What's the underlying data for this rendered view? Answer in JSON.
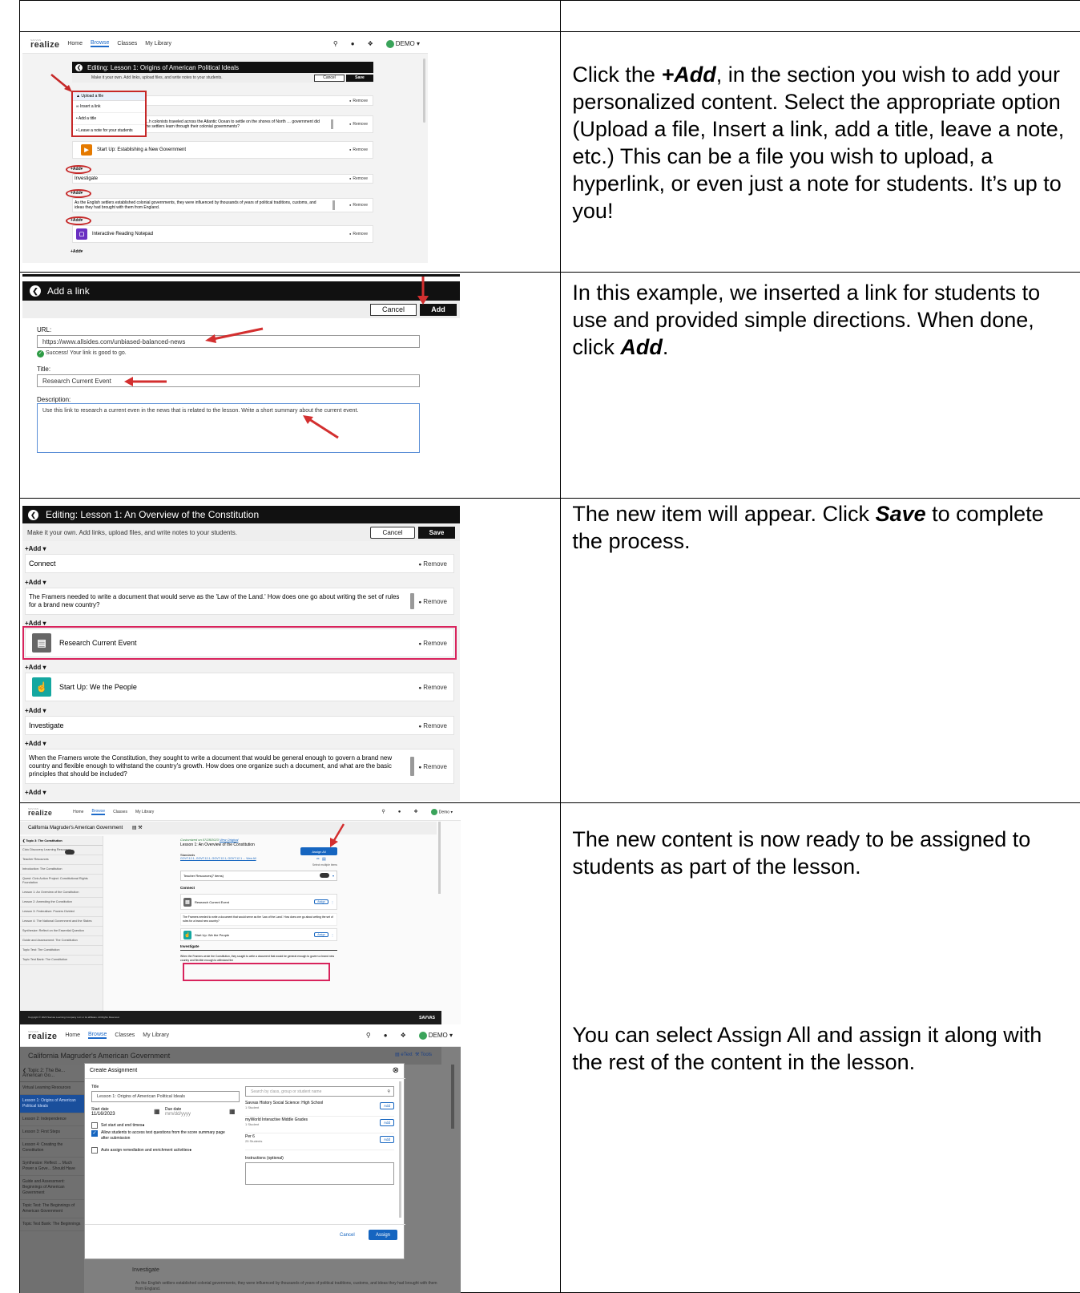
{
  "rows": [
    {
      "instruction_html": "Click the <b><i>+Add</i></b>, in the section you wish to add your personalized content.  Select the appropriate option (Upload a file, Insert a link, add a title, leave a note, etc.) This can be a file you wish to upload, a hyperlink, or even just a note for students.  It’s up to you!"
    },
    {
      "instruction_html": "In this example, we inserted a link for students to use and provided simple directions.  When done, click <b><i>Add</i></b>."
    },
    {
      "instruction_html": "The new item will appear.  Click <b><i>Save</i></b> to complete the process."
    },
    {
      "instruction_html": "The new content is now ready to be assigned to students as part of the lesson."
    },
    {
      "instruction_html": "You can select Assign All and assign it along with the rest of the content in the lesson."
    }
  ],
  "nav": {
    "logo": "realize",
    "logo_small": "SAVVAS",
    "home": "Home",
    "browse": "Browse",
    "classes": "Classes",
    "my_library": "My Library",
    "user": "DEMO ▾",
    "user2": "Demo ▾"
  },
  "ss1": {
    "title": "Editing: Lesson 1: Origins of American Political Ideals",
    "sub": "Make it your own. Add links, upload files, and write notes to your students.",
    "cancel": "Cancel",
    "save": "Save",
    "menu": [
      "Upload a file",
      "Insert a link",
      "Add a title",
      "Leave a note for your students"
    ],
    "item1": "Connect",
    "item2": "…h colonists traveled across the Atlantic Ocean to settle on the shores of North … government did the settlers learn through their colonial governments?",
    "item3": "Start Up: Establishing a New Government",
    "item4": "Investigate",
    "item5": "As the English settlers established colonial governments, they were influenced by thousands of years of political traditions, customs, and ideas they had brought with them from England.",
    "item6": "Interactive Reading Notepad",
    "add": "+Add▾",
    "remove": "Remove"
  },
  "ss2": {
    "title": "Add a link",
    "cancel": "Cancel",
    "add": "Add",
    "url_label": "URL:",
    "url_value": "https://www.allsides.com/unbiased-balanced-news",
    "success": "Success! Your link is good to go.",
    "title_label": "Title:",
    "title_value": "Research Current Event",
    "desc_label": "Description:",
    "desc_value": "Use this link to research a current even in the news that is related to the lesson.  Write a short summary about the current event."
  },
  "ss3": {
    "title": "Editing: Lesson 1: An Overview of the Constitution",
    "sub": "Make it your own. Add links, upload files, and write notes to your students.",
    "cancel": "Cancel",
    "save": "Save",
    "add": "+Add ▾",
    "remove": "Remove",
    "item1": "Connect",
    "item2": "The Framers needed to write a document that would serve as the 'Law of the Land.' How does one go about writing the set of rules for a brand new country?",
    "item3": "Research Current Event",
    "item4": "Start Up: We the People",
    "item5": "Investigate",
    "item6": "When the Framers wrote the Constitution, they sought to write a document that would be general enough to govern a brand new country and flexible enough to withstand the country's growth. How does one organize such a document, and what are the basic principles that should be included?"
  },
  "ss4": {
    "book": "California Magruder's American Government",
    "topic": "Topic 3: The Constitution",
    "side": [
      "Civic Discovery Learning Resources",
      "Teacher Resources",
      "Introduction: The Constitution",
      "Quest: Civic Action Project: Constitutional Rights Foundation",
      "Lesson 1: An Overview of the Constitution",
      "Lesson 2: Amending the Constitution",
      "Lesson 3: Federalism: Powers Divided",
      "Lesson 4: The National Government and the States",
      "Synthesize: Reflect on the Essential Question",
      "Guide and Assessment: The Constitution",
      "Topic Test: The Constitution",
      "Topic Test Bank: The Constitution"
    ],
    "customized": "Customized on 07/28/2023",
    "view_original": "View Original",
    "lesson": "Lesson 1: An Overview of the Constitution",
    "assign_all": "Assign All",
    "standards": "Standards",
    "standards_links": "GOVT.12.1, GOVT.12.1, GOVT.12.1, GOVT.12.1 ... View All",
    "select_multiple": "Select multiple items",
    "teacher_resources": "Teacher Resources(7 items)",
    "connect": "Connect",
    "item_rce": "Research Current Event",
    "assign": "Assign",
    "framers": "The Framers needed to write a document that would serve as the 'Law of the Land.' How does one go about writing the set of rules for a brand new country?",
    "start_up": "Start Up: We the People",
    "investigate": "Investigate",
    "when": "When the Framers wrote the Constitution, they sought to write a document that would be general enough to govern a brand new country and flexible enough to withstand the",
    "footer": "Copyright © 2023 Savvas Learning Company LLC or its affiliates. All Rights Reserved.",
    "footer_logo": "SAVVAS"
  },
  "ss5": {
    "book": "California Magruder's American Government",
    "etext": "eText",
    "tools": "Tools",
    "topic": "Topic 2: The Be... American Go...",
    "side": [
      "Virtual Learning Resources",
      "Lesson 1: Origins of American Political Ideals",
      "Lesson 2: Independence",
      "Lesson 3: First Steps",
      "Lesson 4: Creating the Constitution",
      "Synthesize: Reflect ... Much Power a Gove... Should Have",
      "Guide and Assessment: Beginnings of American Government",
      "Topic Test: The Beginnings of American Government",
      "Topic Test Bank: The Beginnings"
    ],
    "dialog_title": "Create Assignment",
    "title_label": "Title",
    "title_value": "Lesson 1: Origins of American Political Ideals",
    "start_label": "Start date",
    "start_value": "11/16/2023",
    "due_label": "Due date",
    "due_placeholder": "mm/dd/yyyy",
    "chk1": "Set start and end times",
    "chk2": "Allow students to access test questions from the score summary page after submission",
    "chk3": "Auto assign remediation and enrichment activities",
    "search_placeholder": "Search by class, group or student name",
    "classes": [
      {
        "name": "Savvas History Social Science: High School",
        "count": "1 Student"
      },
      {
        "name": "myWorld Interactive Middle Grades",
        "count": "1 Student"
      },
      {
        "name": "Per 6",
        "count": "25 Students"
      }
    ],
    "add": "Add",
    "instructions_label": "Instructions (optional)",
    "cancel": "Cancel",
    "assign": "Assign",
    "investigate": "Investigate",
    "bottom_text": "As the English settlers established colonial governments, they were influenced by thousands of years of political traditions, customs, and ideas they had brought with them from England."
  },
  "colors": {
    "black": "#111111",
    "blue": "#1565c0",
    "red": "#c62828",
    "pink": "#d8235c",
    "green": "#3aa35a"
  }
}
